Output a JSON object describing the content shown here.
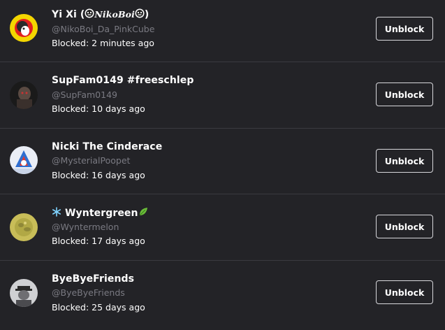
{
  "blocked_users": [
    {
      "display_name_prefix": "Yi Xi (",
      "display_name_fancy": "NikoBoi",
      "display_name_suffix": ")",
      "handle": "@NikoBoi_Da_PinkCube",
      "blocked_text": "Blocked: 2 minutes ago",
      "button_label": "Unblock"
    },
    {
      "display_name": "SupFam0149 #freeschlep",
      "handle": "@SupFam0149",
      "blocked_text": "Blocked: 10 days ago",
      "button_label": "Unblock"
    },
    {
      "display_name": "Nicki The Cinderace",
      "handle": "@MysterialPoopet",
      "blocked_text": "Blocked: 16 days ago",
      "button_label": "Unblock"
    },
    {
      "display_name": "Wyntergreen",
      "handle": "@Wyntermelon",
      "blocked_text": "Blocked: 17 days ago",
      "button_label": "Unblock"
    },
    {
      "display_name": "ByeByeFriends",
      "handle": "@ByeByeFriends",
      "blocked_text": "Blocked: 25 days ago",
      "button_label": "Unblock"
    }
  ],
  "icons": {
    "row0_name_emoji": "hot-face-emoji",
    "row3_name_prefix_emoji": "snowflake-emoji",
    "row3_name_suffix_emoji": "leaf-emoji"
  },
  "colors": {
    "background": "#232327",
    "divider": "#3a3a40",
    "handle_text": "#7a7a82",
    "text": "#ffffff",
    "button_border": "#d8d8dc"
  }
}
